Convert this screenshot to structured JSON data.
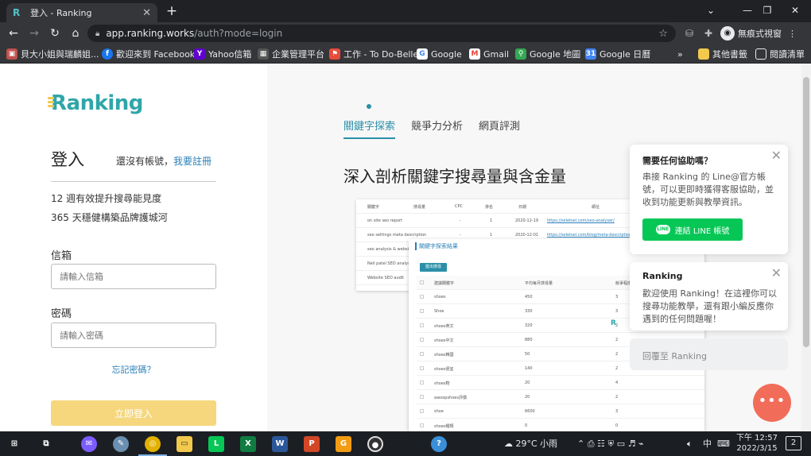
{
  "browser": {
    "tab_title": "登入 - Ranking",
    "tab_favicon": "R",
    "new_tab": "+",
    "url_host": "app.ranking.works",
    "url_path": "/auth?mode=login",
    "profile_label": "無痕式視窗"
  },
  "bookmarks": [
    {
      "label": "貝大小姐與瑞麟姐...",
      "icon": "profile-icon",
      "color": "#c0504d"
    },
    {
      "label": "歡迎來到 Facebook",
      "icon": "facebook-icon",
      "color": "#1877f2"
    },
    {
      "label": "Yahoo信箱",
      "icon": "yahoo-icon",
      "color": "#6001d2"
    },
    {
      "label": "企業管理平台",
      "icon": "grid-icon",
      "color": "#555555"
    },
    {
      "label": "工作 - To Do-Belle",
      "icon": "flag-icon",
      "color": "#e74c3c"
    },
    {
      "label": "Google",
      "icon": "google-icon",
      "color": "#4285f4"
    },
    {
      "label": "Gmail",
      "icon": "gmail-icon",
      "color": "#ea4335"
    },
    {
      "label": "Google 地圖",
      "icon": "maps-icon",
      "color": "#34a853"
    },
    {
      "label": "Google 日曆",
      "icon": "calendar-icon",
      "color": "#4285f4"
    }
  ],
  "bookmarks_more": "»",
  "bookmarks_other": "其他書籤",
  "bookmarks_reading": "閱讀清單",
  "login": {
    "logo": "Ranking",
    "title": "登入",
    "no_account": "還沒有帳號，",
    "register_link": "我要註冊",
    "tagline_1": "12 週有效提升搜尋能見度",
    "tagline_2": "365 天穩健構築品牌護城河",
    "email_label": "信箱",
    "email_placeholder": "請輸入信箱",
    "password_label": "密碼",
    "password_placeholder": "請輸入密碼",
    "forgot": "忘記密碼？",
    "submit": "立即登入"
  },
  "promo": {
    "tabs": [
      "關鍵字探索",
      "競爭力分析",
      "網頁評測"
    ],
    "headline": "深入剖析關鍵字搜尋量與含金量"
  },
  "preview_back": {
    "headers": [
      "關鍵字",
      "搜尋量",
      "CPC",
      "排名",
      "日期",
      "網址"
    ],
    "rows": [
      [
        "on site seo report",
        "-",
        "1",
        "2020-12-19",
        "https://seletsel.com/seo-analyser/"
      ],
      [
        "seo settings meta description",
        "-",
        "1",
        "2020-12-01",
        "https://seletsel.com/blog/meta-description-str..."
      ],
      [
        "seo analysis & website review by woorank",
        "",
        "",
        "",
        ""
      ],
      [
        "Neil patel SEO analyser",
        "",
        "",
        "",
        ""
      ],
      [
        "Website SEO audit",
        "",
        "",
        "",
        ""
      ]
    ]
  },
  "preview_front": {
    "title": "關鍵字探索結果",
    "export_btn": "匯出搜尋",
    "headers": [
      "建議關鍵字",
      "平均每月搜尋量",
      "競爭程度"
    ],
    "rows": [
      [
        "shoes",
        "450",
        "3"
      ],
      [
        "Shoe",
        "330",
        "3"
      ],
      [
        "shoes英文",
        "320",
        "2"
      ],
      [
        "shoes中文",
        "880",
        "2"
      ],
      [
        "shoes韓國",
        "50",
        "2"
      ],
      [
        "shoes便宜",
        "140",
        "2"
      ],
      [
        "shoes鞋",
        "20",
        "4"
      ],
      [
        "awoopshoes評價",
        "20",
        "2"
      ],
      [
        "shoe",
        "6600",
        "3"
      ],
      [
        "shoes種類",
        "0",
        "0"
      ]
    ]
  },
  "help_card": {
    "title": "需要任何協助嗎？",
    "body": "串接 Ranking 的 Line@官方帳號，可以更即時獲得客服協助，並收到功能更新與教學資訊。",
    "line_button": "連結 LINE 帳號",
    "line_badge": "LINE"
  },
  "welcome_card": {
    "title": "Ranking",
    "body": "歡迎使用 Ranking！在這裡你可以搜尋功能教學，還有跟小編反應你遇到的任何問題喔！"
  },
  "reply_placeholder": "回覆至 Ranking",
  "chat_bubble": "•••",
  "taskbar": {
    "weather": "29°C 小雨",
    "ime": "中",
    "time": "下午 12:57",
    "date": "2022/3/15",
    "notifications": "2"
  }
}
